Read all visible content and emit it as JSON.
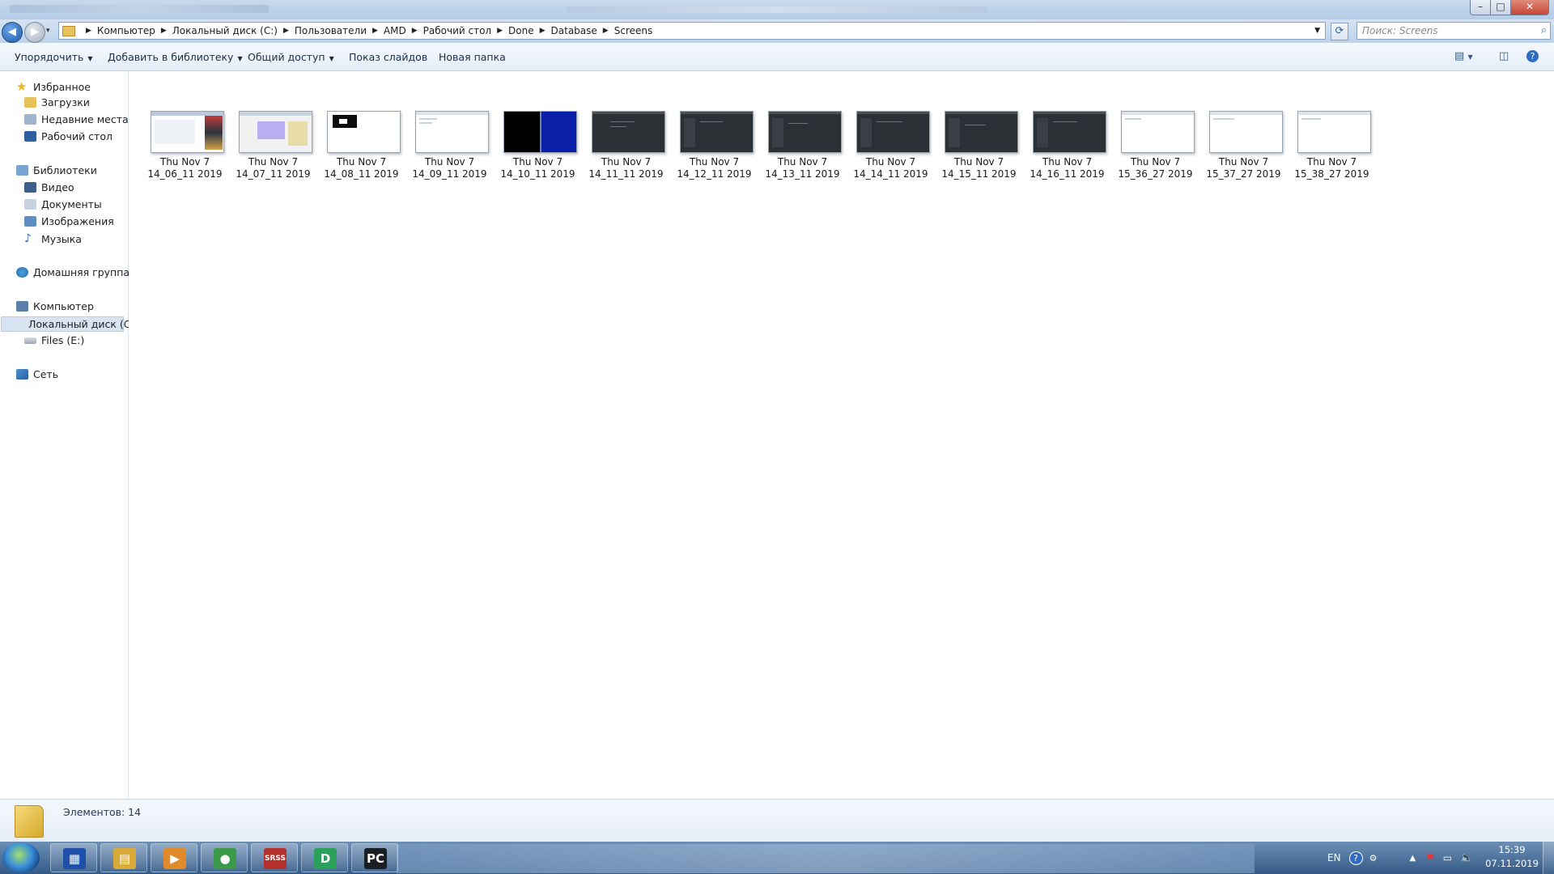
{
  "window": {
    "controls": {
      "minimize": "–",
      "maximize": "□",
      "close": "✕"
    }
  },
  "address": {
    "crumbs": [
      "Компьютер",
      "Локальный диск (C:)",
      "Пользователи",
      "AMD",
      "Рабочий стол",
      "Done",
      "Database",
      "Screens"
    ],
    "search_placeholder": "Поиск: Screens"
  },
  "toolbar": {
    "organize": "Упорядочить",
    "add_to_library": "Добавить в библиотеку",
    "share": "Общий доступ",
    "slideshow": "Показ слайдов",
    "new_folder": "Новая папка"
  },
  "nav": {
    "favorites": "Избранное",
    "downloads": "Загрузки",
    "recent": "Недавние места",
    "desktop": "Рабочий стол",
    "libraries": "Библиотеки",
    "video": "Видео",
    "documents": "Документы",
    "images": "Изображения",
    "music": "Музыка",
    "homegroup": "Домашняя группа",
    "computer": "Компьютер",
    "local_disk": "Локальный диск (C",
    "files_e": "Files (E:)",
    "network": "Сеть"
  },
  "files": [
    {
      "line1": "Thu Nov  7",
      "line2": "14_06_11 2019",
      "thumb": "mixed"
    },
    {
      "line1": "Thu Nov  7",
      "line2": "14_07_11 2019",
      "thumb": "lilac"
    },
    {
      "line1": "Thu Nov  7",
      "line2": "14_08_11 2019",
      "thumb": "black-box"
    },
    {
      "line1": "Thu Nov  7",
      "line2": "14_09_11 2019",
      "thumb": "white"
    },
    {
      "line1": "Thu Nov  7",
      "line2": "14_10_11 2019",
      "thumb": "blue"
    },
    {
      "line1": "Thu Nov  7",
      "line2": "14_11_11 2019",
      "thumb": "dark"
    },
    {
      "line1": "Thu Nov  7",
      "line2": "14_12_11 2019",
      "thumb": "dark"
    },
    {
      "line1": "Thu Nov  7",
      "line2": "14_13_11 2019",
      "thumb": "dark"
    },
    {
      "line1": "Thu Nov  7",
      "line2": "14_14_11 2019",
      "thumb": "dark"
    },
    {
      "line1": "Thu Nov  7",
      "line2": "14_15_11 2019",
      "thumb": "dark"
    },
    {
      "line1": "Thu Nov  7",
      "line2": "14_16_11 2019",
      "thumb": "dark"
    },
    {
      "line1": "Thu Nov  7",
      "line2": "15_36_27 2019",
      "thumb": "white"
    },
    {
      "line1": "Thu Nov  7",
      "line2": "15_37_27 2019",
      "thumb": "white"
    },
    {
      "line1": "Thu Nov  7",
      "line2": "15_38_27 2019",
      "thumb": "white"
    }
  ],
  "status": {
    "item_count": "Элементов: 14"
  },
  "taskbar": {
    "apps": [
      {
        "name": "task-manager-icon",
        "glyph": "▦",
        "color": "#1f4fa8"
      },
      {
        "name": "explorer-icon",
        "glyph": "▤",
        "color": "#d9a93a"
      },
      {
        "name": "media-player-icon",
        "glyph": "▶",
        "color": "#e08a2a"
      },
      {
        "name": "chrome-icon",
        "glyph": "●",
        "color": "#3a9a4a"
      },
      {
        "name": "srss-icon",
        "glyph": "SRSS",
        "color": "#b3302c"
      },
      {
        "name": "datagrip-icon",
        "glyph": "D",
        "color": "#2aa05a"
      },
      {
        "name": "pycharm-icon",
        "glyph": "PC",
        "color": "#1b1f24"
      }
    ],
    "lang": "EN",
    "time": "15:39",
    "date": "07.11.2019"
  },
  "colors": {
    "accent": "#3a6ea5",
    "selection": "#d9e4f3",
    "taskbar": "#355a86"
  }
}
